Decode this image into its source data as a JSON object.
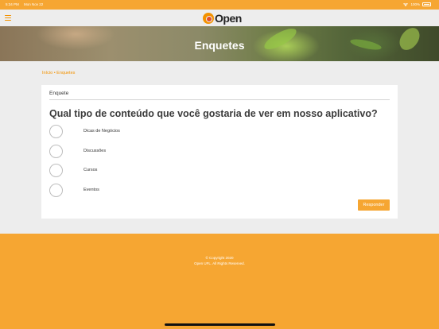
{
  "status_bar": {
    "time": "5:34 PM",
    "date": "Mon Nov 22",
    "battery": "100%"
  },
  "navbar": {
    "logo_text": "Open"
  },
  "hero": {
    "title": "Enquetes"
  },
  "breadcrumb": {
    "home": "Início",
    "separator": "•",
    "current": "Enquetes"
  },
  "poll": {
    "header": "Enquete",
    "question": "Qual tipo de conteúdo que você gostaria de ver em nosso aplicativo?",
    "options": [
      {
        "label": "Dicas de Negócios"
      },
      {
        "label": "Discussões"
      },
      {
        "label": "Cursos"
      },
      {
        "label": "Eventos"
      }
    ],
    "submit_label": "Responder"
  },
  "footer": {
    "copyright": "© Copyright 2020",
    "rights": "Open UFL. All Rights Reserved."
  },
  "colors": {
    "accent": "#f6a632",
    "accent_text": "#f39200",
    "background": "#ededed"
  }
}
